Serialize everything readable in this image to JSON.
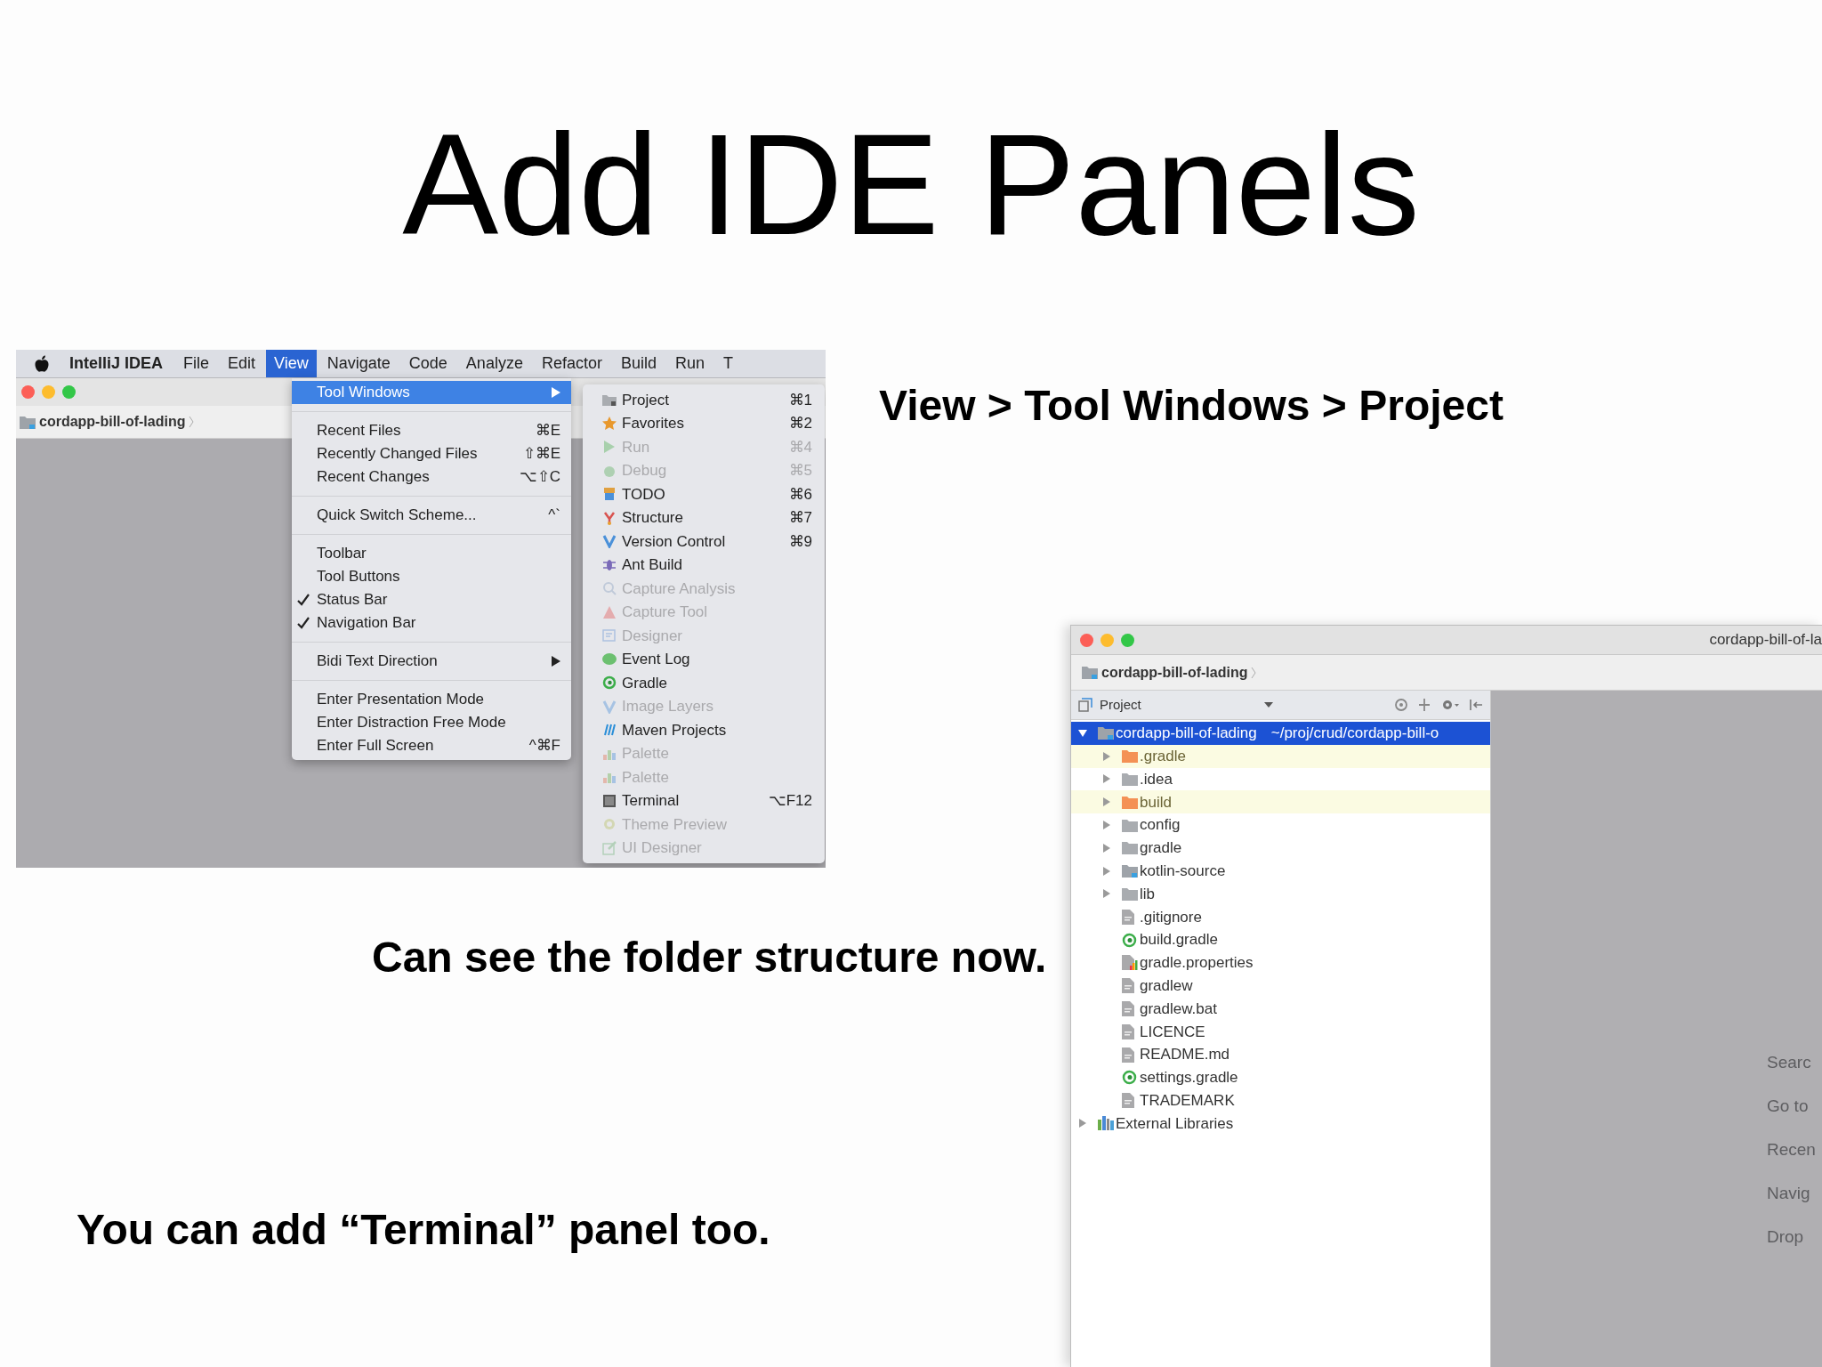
{
  "title": "Add IDE Panels",
  "menu_screenshot": {
    "app_name": "IntelliJ IDEA",
    "menus": [
      {
        "label": "File",
        "selected": false
      },
      {
        "label": "Edit",
        "selected": false
      },
      {
        "label": "View",
        "selected": true
      },
      {
        "label": "Navigate",
        "selected": false
      },
      {
        "label": "Code",
        "selected": false
      },
      {
        "label": "Analyze",
        "selected": false
      },
      {
        "label": "Refactor",
        "selected": false
      },
      {
        "label": "Build",
        "selected": false
      },
      {
        "label": "Run",
        "selected": false
      },
      {
        "label": "T",
        "selected": false
      }
    ],
    "breadcrumb": "cordapp-bill-of-lading",
    "view_menu": [
      [
        {
          "label": "Tool Windows",
          "selected": true,
          "checked": false,
          "submenu": true
        }
      ],
      [
        {
          "label": "Recent Files",
          "shortcut": "⌘E",
          "selected": false,
          "checked": false,
          "submenu": false
        },
        {
          "label": "Recently Changed Files",
          "shortcut": "⇧⌘E",
          "selected": false,
          "checked": false,
          "submenu": false
        },
        {
          "label": "Recent Changes",
          "shortcut": "⌥⇧C",
          "selected": false,
          "checked": false,
          "submenu": false
        }
      ],
      [
        {
          "label": "Quick Switch Scheme...",
          "shortcut": "^`",
          "selected": false,
          "checked": false,
          "submenu": false
        }
      ],
      [
        {
          "label": "Toolbar",
          "selected": false,
          "checked": false,
          "submenu": false
        },
        {
          "label": "Tool Buttons",
          "selected": false,
          "checked": false,
          "submenu": false
        },
        {
          "label": "Status Bar",
          "selected": false,
          "checked": true,
          "submenu": false
        },
        {
          "label": "Navigation Bar",
          "selected": false,
          "checked": true,
          "submenu": false
        }
      ],
      [
        {
          "label": "Bidi Text Direction",
          "selected": false,
          "checked": false,
          "submenu": true
        }
      ],
      [
        {
          "label": "Enter Presentation Mode",
          "selected": false,
          "checked": false,
          "submenu": false
        },
        {
          "label": "Enter Distraction Free Mode",
          "selected": false,
          "checked": false,
          "submenu": false
        },
        {
          "label": "Enter Full Screen",
          "shortcut": "^⌘F",
          "selected": false,
          "checked": false,
          "submenu": false
        }
      ]
    ],
    "tool_windows_menu": [
      {
        "label": "Project",
        "shortcut": "⌘1",
        "kind": "project",
        "disabled": false
      },
      {
        "label": "Favorites",
        "shortcut": "⌘2",
        "kind": "favorites",
        "disabled": false
      },
      {
        "label": "Run",
        "shortcut": "⌘4",
        "kind": "run",
        "disabled": true
      },
      {
        "label": "Debug",
        "shortcut": "⌘5",
        "kind": "debug",
        "disabled": true
      },
      {
        "label": "TODO",
        "shortcut": "⌘6",
        "kind": "todo",
        "disabled": false
      },
      {
        "label": "Structure",
        "shortcut": "⌘7",
        "kind": "structure",
        "disabled": false
      },
      {
        "label": "Version Control",
        "shortcut": "⌘9",
        "kind": "vcs",
        "disabled": false
      },
      {
        "label": "Ant Build",
        "kind": "ant",
        "disabled": false
      },
      {
        "label": "Capture Analysis",
        "kind": "capture",
        "disabled": true
      },
      {
        "label": "Capture Tool",
        "kind": "capture_tool",
        "disabled": true
      },
      {
        "label": "Designer",
        "kind": "designer",
        "disabled": true
      },
      {
        "label": "Event Log",
        "kind": "event_log",
        "disabled": false
      },
      {
        "label": "Gradle",
        "kind": "gradle",
        "disabled": false
      },
      {
        "label": "Image Layers",
        "kind": "vcs",
        "disabled": true
      },
      {
        "label": "Maven Projects",
        "kind": "maven",
        "disabled": false
      },
      {
        "label": "Palette",
        "kind": "palette",
        "disabled": true
      },
      {
        "label": "Palette",
        "kind": "palette",
        "disabled": true
      },
      {
        "label": "Terminal",
        "shortcut": "⌥F12",
        "kind": "terminal",
        "disabled": false
      },
      {
        "label": "Theme Preview",
        "kind": "theme",
        "disabled": true
      },
      {
        "label": "UI Designer",
        "kind": "ui_designer",
        "disabled": true
      }
    ]
  },
  "captions": [
    "View > Tool Windows > Project",
    "Can see the folder structure now.",
    "You can add “Terminal” panel too."
  ],
  "project_screenshot": {
    "window_title": "cordapp-bill-of-la",
    "breadcrumb": "cordapp-bill-of-lading",
    "panel_title": "Project",
    "tree": [
      {
        "label": "cordapp-bill-of-lading",
        "path": "~/proj/crud/cordapp-bill-o",
        "kind": "module",
        "selected": true,
        "expanded": true,
        "children": [
          {
            "label": ".gradle",
            "kind": "excluded",
            "selected": false,
            "expanded": false
          },
          {
            "label": ".idea",
            "kind": "folder",
            "selected": false,
            "expanded": false
          },
          {
            "label": "build",
            "kind": "excluded",
            "selected": false,
            "expanded": false
          },
          {
            "label": "config",
            "kind": "folder",
            "selected": false,
            "expanded": false
          },
          {
            "label": "gradle",
            "kind": "folder",
            "selected": false,
            "expanded": false
          },
          {
            "label": "kotlin-source",
            "kind": "module",
            "selected": false,
            "expanded": false
          },
          {
            "label": "lib",
            "kind": "folder",
            "selected": false,
            "expanded": false
          },
          {
            "label": ".gitignore",
            "kind": "file",
            "selected": false
          },
          {
            "label": "build.gradle",
            "kind": "gradle",
            "selected": false
          },
          {
            "label": "gradle.properties",
            "kind": "properties",
            "selected": false
          },
          {
            "label": "gradlew",
            "kind": "file",
            "selected": false
          },
          {
            "label": "gradlew.bat",
            "kind": "file",
            "selected": false
          },
          {
            "label": "LICENCE",
            "kind": "file",
            "selected": false
          },
          {
            "label": "README.md",
            "kind": "file",
            "selected": false
          },
          {
            "label": "settings.gradle",
            "kind": "gradle",
            "selected": false
          },
          {
            "label": "TRADEMARK",
            "kind": "file",
            "selected": false
          }
        ]
      },
      {
        "label": "External Libraries",
        "kind": "libraries",
        "selected": false,
        "expanded": false
      }
    ],
    "editor_hints": [
      "Searc",
      "Go to",
      "Recen",
      "Navig",
      "Drop"
    ]
  }
}
